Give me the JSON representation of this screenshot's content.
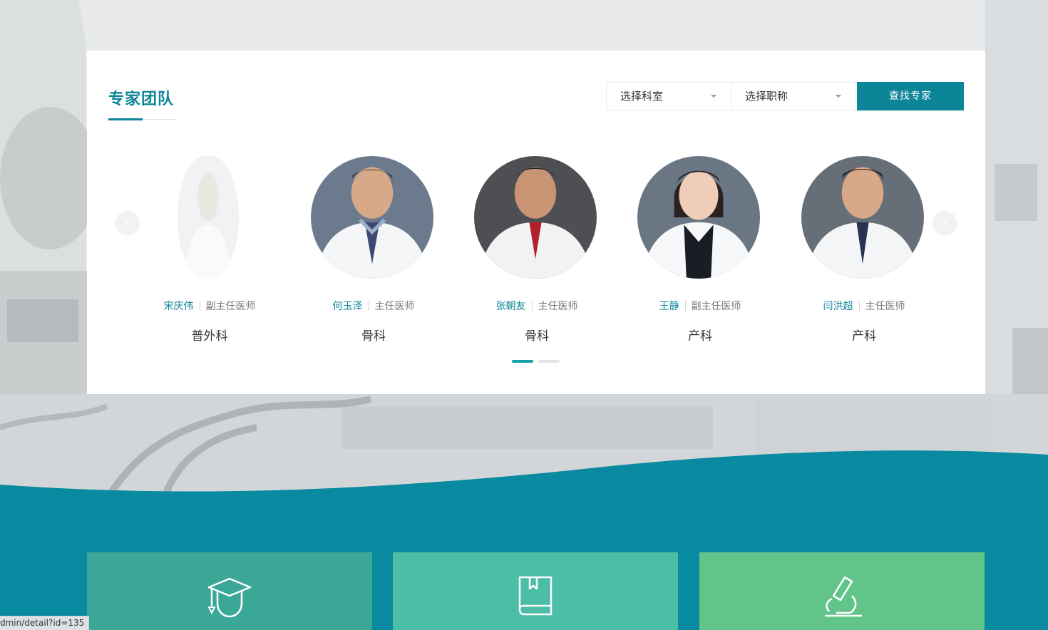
{
  "section": {
    "title": "专家团队"
  },
  "filters": {
    "department_placeholder": "选择科室",
    "title_placeholder": "选择职称",
    "search_label": "查找专家"
  },
  "doctors": [
    {
      "name": "宋庆伟",
      "rank": "副主任医师",
      "dept": "普外科"
    },
    {
      "name": "何玉泽",
      "rank": "主任医师",
      "dept": "骨科"
    },
    {
      "name": "张朝友",
      "rank": "主任医师",
      "dept": "骨科"
    },
    {
      "name": "王静",
      "rank": "副主任医师",
      "dept": "产科"
    },
    {
      "name": "闫洪超",
      "rank": "主任医师",
      "dept": "产科"
    }
  ],
  "carousel": {
    "prev_icon": "chevron-left-icon",
    "next_icon": "chevron-right-icon",
    "active_page": 1,
    "page_count": 2
  },
  "features": [
    {
      "icon": "graduation-cap-icon"
    },
    {
      "icon": "book-icon"
    },
    {
      "icon": "microscope-icon"
    }
  ],
  "status_bar": {
    "url": "dmin/detail?id=135"
  },
  "colors": {
    "accent": "#0b8597",
    "teal_band": "#0a8aa0",
    "feature_1": "#3aa797",
    "feature_2": "#4cbea8",
    "feature_3": "#62c489"
  }
}
